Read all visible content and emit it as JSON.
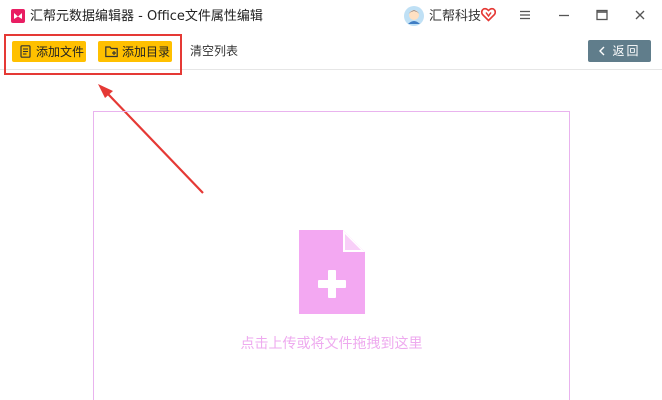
{
  "app": {
    "title": "汇帮元数据编辑器 - Office文件属性编辑",
    "logo_icon": "app-logo-icon"
  },
  "user": {
    "name": "汇帮科技",
    "avatar_icon": "user-avatar-icon",
    "badge_icon": "vip-heart-icon"
  },
  "window_controls": [
    "menu-icon",
    "minimize-icon",
    "maximize-icon",
    "close-icon"
  ],
  "toolbar": {
    "add_file_label": "添加文件",
    "add_dir_label": "添加目录",
    "clear_label": "清空列表",
    "back_label": "返回"
  },
  "drop_zone": {
    "hint": "点击上传或将文件拖拽到这里",
    "icon": "file-add-icon"
  },
  "colors": {
    "accent_button": "#ffc000",
    "back_button": "#607d8b",
    "annotation": "#e53935",
    "drop_border": "#e9b3ee",
    "drop_icon": "#f3a8f2",
    "drop_text": "#eeaaef"
  }
}
